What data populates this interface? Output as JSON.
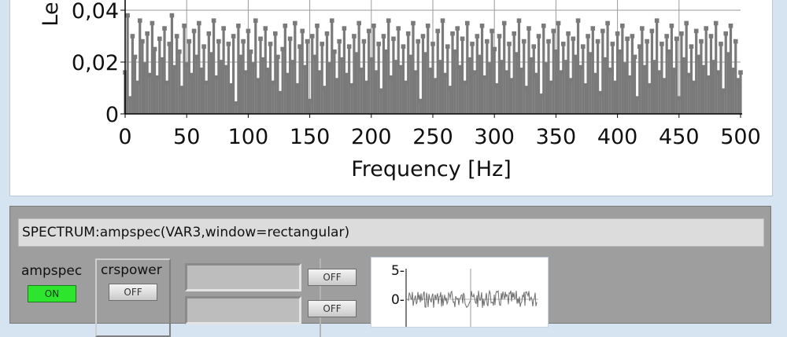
{
  "main_chart": {
    "xlabel": "Frequency [Hz]",
    "ylabel": "Le",
    "x_ticks": [
      "0",
      "50",
      "100",
      "150",
      "200",
      "250",
      "300",
      "350",
      "400",
      "450",
      "500"
    ],
    "y_ticks": [
      "0",
      "0,02",
      "0,04"
    ],
    "colors": {
      "series": "#7a7a7a",
      "grid": "#9a9a9a",
      "frame": "#000000"
    }
  },
  "chart_data": {
    "type": "bar",
    "xlim": [
      0,
      500
    ],
    "ylim": [
      0,
      0.05
    ],
    "grid": true,
    "x": [
      0,
      2,
      4,
      6,
      8,
      10,
      12,
      14,
      16,
      18,
      20,
      22,
      24,
      26,
      28,
      30,
      32,
      34,
      36,
      38,
      40,
      42,
      44,
      46,
      48,
      50,
      52,
      54,
      56,
      58,
      60,
      62,
      64,
      66,
      68,
      70,
      72,
      74,
      76,
      78,
      80,
      82,
      84,
      86,
      88,
      90,
      92,
      94,
      96,
      98,
      100,
      102,
      104,
      106,
      108,
      110,
      112,
      114,
      116,
      118,
      120,
      122,
      124,
      126,
      128,
      130,
      132,
      134,
      136,
      138,
      140,
      142,
      144,
      146,
      148,
      150,
      152,
      154,
      156,
      158,
      160,
      162,
      164,
      166,
      168,
      170,
      172,
      174,
      176,
      178,
      180,
      182,
      184,
      186,
      188,
      190,
      192,
      194,
      196,
      198,
      200,
      202,
      204,
      206,
      208,
      210,
      212,
      214,
      216,
      218,
      220,
      222,
      224,
      226,
      228,
      230,
      232,
      234,
      236,
      238,
      240,
      242,
      244,
      246,
      248,
      250,
      252,
      254,
      256,
      258,
      260,
      262,
      264,
      266,
      268,
      270,
      272,
      274,
      276,
      278,
      280,
      282,
      284,
      286,
      288,
      290,
      292,
      294,
      296,
      298,
      300,
      302,
      304,
      306,
      308,
      310,
      312,
      314,
      316,
      318,
      320,
      322,
      324,
      326,
      328,
      330,
      332,
      334,
      336,
      338,
      340,
      342,
      344,
      346,
      348,
      350,
      352,
      354,
      356,
      358,
      360,
      362,
      364,
      366,
      368,
      370,
      372,
      374,
      376,
      378,
      380,
      382,
      384,
      386,
      388,
      390,
      392,
      394,
      396,
      398,
      400,
      402,
      404,
      406,
      408,
      410,
      412,
      414,
      416,
      418,
      420,
      422,
      424,
      426,
      428,
      430,
      432,
      434,
      436,
      438,
      440,
      442,
      444,
      446,
      448,
      450,
      452,
      454,
      456,
      458,
      460,
      462,
      464,
      466,
      468,
      470,
      472,
      474,
      476,
      478,
      480,
      482,
      484,
      486,
      488,
      490,
      492,
      494,
      496,
      498,
      500
    ],
    "values": [
      0.016,
      0.038,
      0.006,
      0.03,
      0.022,
      0.012,
      0.036,
      0.028,
      0.019,
      0.031,
      0.015,
      0.035,
      0.025,
      0.014,
      0.029,
      0.021,
      0.033,
      0.012,
      0.027,
      0.038,
      0.018,
      0.03,
      0.024,
      0.01,
      0.034,
      0.019,
      0.028,
      0.015,
      0.032,
      0.022,
      0.035,
      0.017,
      0.026,
      0.012,
      0.031,
      0.023,
      0.036,
      0.014,
      0.028,
      0.02,
      0.033,
      0.018,
      0.027,
      0.011,
      0.03,
      0.004,
      0.034,
      0.022,
      0.028,
      0.016,
      0.032,
      0.024,
      0.019,
      0.036,
      0.013,
      0.029,
      0.021,
      0.033,
      0.017,
      0.027,
      0.012,
      0.031,
      0.022,
      0.008,
      0.025,
      0.034,
      0.015,
      0.029,
      0.02,
      0.035,
      0.011,
      0.026,
      0.032,
      0.018,
      0.028,
      0.005,
      0.03,
      0.022,
      0.034,
      0.016,
      0.027,
      0.01,
      0.031,
      0.019,
      0.036,
      0.024,
      0.013,
      0.028,
      0.021,
      0.033,
      0.015,
      0.026,
      0.011,
      0.03,
      0.023,
      0.035,
      0.017,
      0.028,
      0.012,
      0.032,
      0.021,
      0.034,
      0.016,
      0.027,
      0.009,
      0.03,
      0.024,
      0.036,
      0.014,
      0.029,
      0.02,
      0.033,
      0.018,
      0.026,
      0.012,
      0.031,
      0.022,
      0.035,
      0.016,
      0.028,
      0.005,
      0.03,
      0.023,
      0.034,
      0.017,
      0.027,
      0.013,
      0.032,
      0.02,
      0.036,
      0.015,
      0.026,
      0.01,
      0.031,
      0.024,
      0.033,
      0.018,
      0.029,
      0.012,
      0.035,
      0.021,
      0.027,
      0.016,
      0.03,
      0.022,
      0.034,
      0.014,
      0.028,
      0.019,
      0.032,
      0.025,
      0.011,
      0.03,
      0.02,
      0.035,
      0.016,
      0.027,
      0.013,
      0.031,
      0.023,
      0.036,
      0.017,
      0.028,
      0.01,
      0.033,
      0.021,
      0.026,
      0.015,
      0.03,
      0.007,
      0.034,
      0.019,
      0.028,
      0.012,
      0.032,
      0.024,
      0.035,
      0.016,
      0.027,
      0.02,
      0.031,
      0.013,
      0.029,
      0.022,
      0.036,
      0.018,
      0.026,
      0.011,
      0.03,
      0.023,
      0.033,
      0.015,
      0.028,
      0.008,
      0.032,
      0.021,
      0.035,
      0.017,
      0.027,
      0.012,
      0.031,
      0.024,
      0.034,
      0.019,
      0.029,
      0.014,
      0.03,
      0.022,
      0.006,
      0.026,
      0.033,
      0.018,
      0.028,
      0.011,
      0.032,
      0.02,
      0.036,
      0.016,
      0.027,
      0.013,
      0.03,
      0.024,
      0.034,
      0.017,
      0.029,
      0.006,
      0.031,
      0.021,
      0.035,
      0.015,
      0.026,
      0.012,
      0.032,
      0.022,
      0.028,
      0.018,
      0.033,
      0.014,
      0.03,
      0.02,
      0.035,
      0.016,
      0.027,
      0.009,
      0.031,
      0.023,
      0.034,
      0.017,
      0.028,
      0.013,
      0.016
    ],
    "ylabel": "Le",
    "xlabel": "Frequency [Hz]"
  },
  "formula": {
    "text": "SPECTRUM:ampspec(VAR3,window=rectangular)"
  },
  "controls": {
    "ampspec": {
      "label": "ampspec",
      "state": "ON"
    },
    "crspower": {
      "label": "crspower",
      "state": "OFF"
    },
    "toggle3": {
      "state": "OFF"
    },
    "toggle4": {
      "state": "OFF"
    }
  },
  "mini_chart": {
    "y_ticks": [
      "5-",
      "0-"
    ],
    "colors": {
      "series": "#6e6e6e",
      "grid": "#9a9a9a"
    }
  }
}
